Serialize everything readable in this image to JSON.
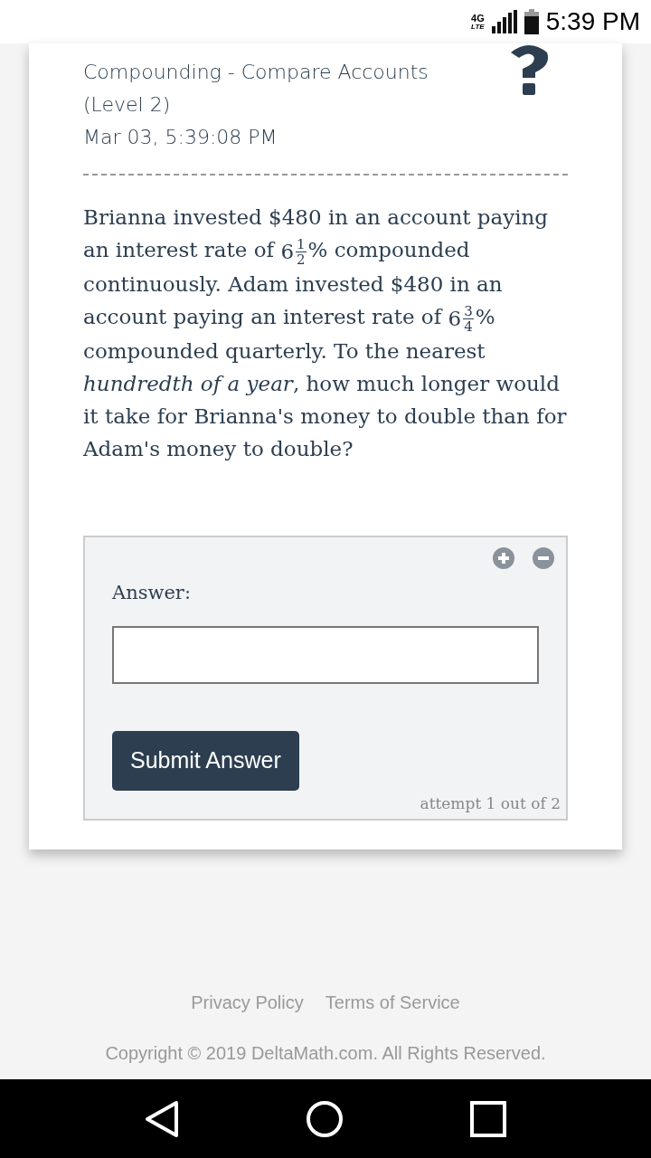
{
  "status_bar": {
    "network": "4G",
    "network_sub": "LTE",
    "time": "5:39 PM"
  },
  "header": {
    "title": "Compounding - Compare Accounts",
    "level": "(Level 2)",
    "timestamp": "Mar 03, 5:39:08 PM"
  },
  "problem": [
    {
      "kind": "text",
      "text": "Brianna invested $480 in an account paying an interest rate of "
    },
    {
      "kind": "mixed",
      "whole": "6",
      "numerator": "1",
      "denominator": "2"
    },
    {
      "kind": "text",
      "text": "% compounded continuously. Adam invested $480 in an account paying an interest rate of "
    },
    {
      "kind": "mixed",
      "whole": "6",
      "numerator": "3",
      "denominator": "4"
    },
    {
      "kind": "text",
      "text": "% compounded quarterly. To the nearest *hundredth of a year*, how much longer would it take for Brianna's money to double than for Adam's money to double?"
    }
  ],
  "answer_panel": {
    "label": "Answer:",
    "button": "Submit Answer",
    "attempts": "attempt 1 out of 2"
  },
  "footer": {
    "links": [
      "Privacy Policy",
      "Terms of Service"
    ],
    "copyright": "Copyright © 2019 DeltaMath.com. All Rights Reserved."
  }
}
